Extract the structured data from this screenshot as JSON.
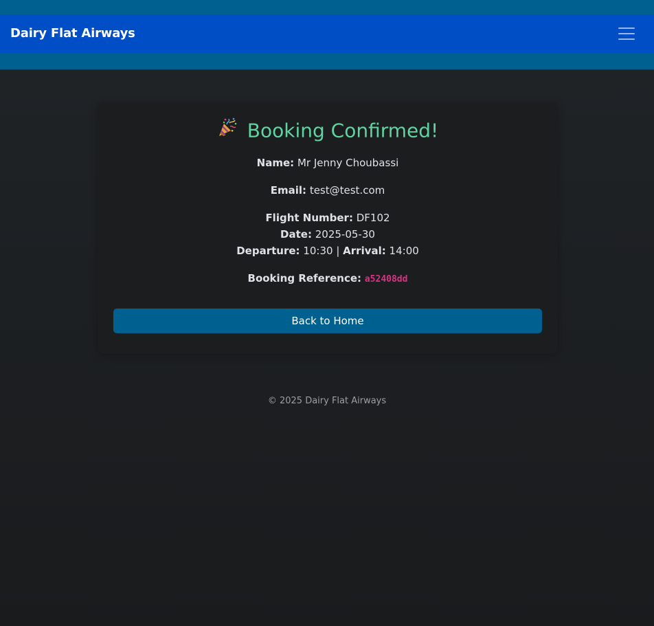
{
  "navbar": {
    "brand": "Dairy Flat Airways",
    "menu_icon": "hamburger-menu-icon"
  },
  "confirmation": {
    "heading_icon": "party-popper-icon",
    "heading": "Booking Confirmed!",
    "name_label": "Name:",
    "name_value": "Mr Jenny Choubassi",
    "email_label": "Email:",
    "email_value": "test@test.com",
    "flight_label": "Flight Number:",
    "flight_value": "DF102",
    "date_label": "Date:",
    "date_value": "2025-05-30",
    "departure_label": "Departure:",
    "departure_value": "10:30",
    "separator": "|",
    "arrival_label": "Arrival:",
    "arrival_value": "14:00",
    "reference_label": "Booking Reference:",
    "reference_value": "a52408dd",
    "back_button": "Back to Home"
  },
  "footer": {
    "text": "© 2025 Dairy Flat Airways"
  },
  "colors": {
    "navbar": "#004ec6",
    "band": "#00608f",
    "heading": "#5fd3a0",
    "reference": "#d63384",
    "button": "#00608f"
  }
}
